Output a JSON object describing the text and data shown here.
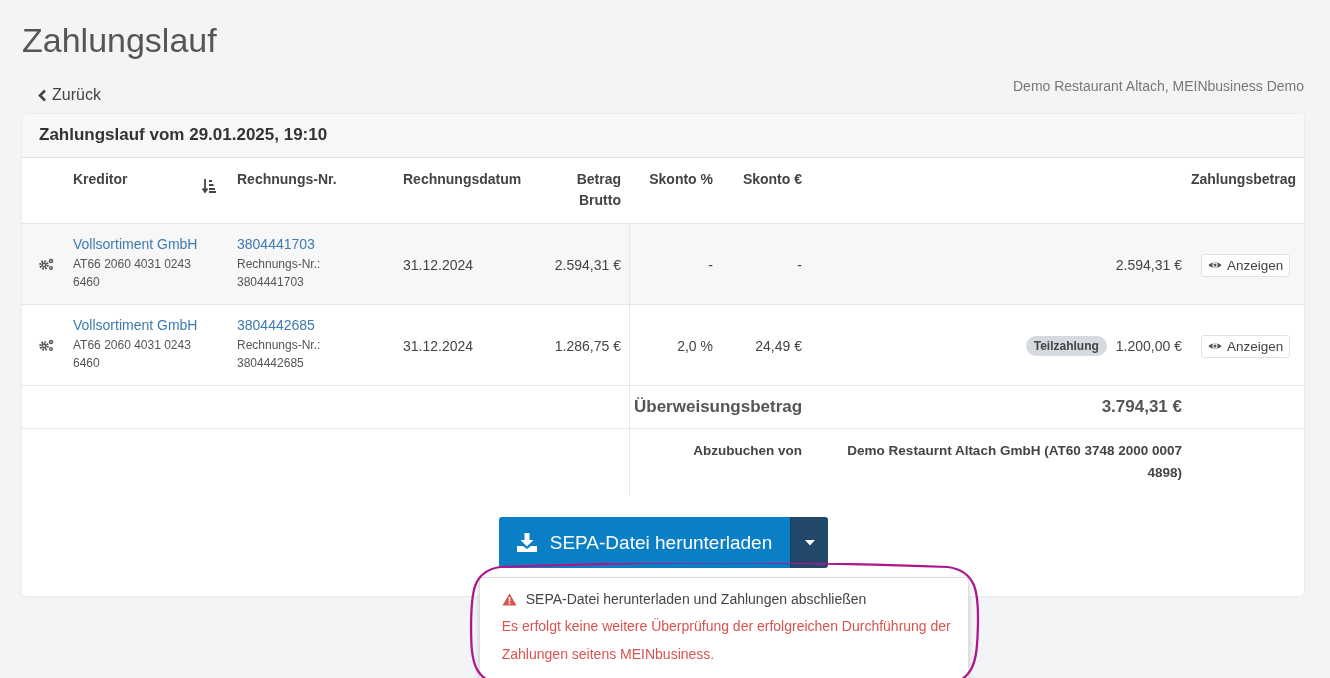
{
  "page": {
    "title": "Zahlungslauf",
    "back_link": "Zurück",
    "company": "Demo Restaurant Altach, MEINbusiness Demo"
  },
  "card": {
    "title": "Zahlungslauf vom 29.01.2025, 19:10"
  },
  "table": {
    "columns": [
      {
        "label": "Kreditor",
        "sorted": true
      },
      {
        "label": "Rechnungs-Nr.",
        "sorted": false
      },
      {
        "label": "Rechnungsdatum",
        "sorted": false
      },
      {
        "label": "Betrag Brutto",
        "sorted": false
      },
      {
        "label": "Skonto %",
        "sorted": false
      },
      {
        "label": "Skonto €",
        "sorted": false
      },
      {
        "label": "Zahlungsbetrag",
        "sorted": false
      }
    ],
    "rows": [
      {
        "creditor": "Vollsortiment GmbH",
        "iban": "AT66 2060 4031 0243 6460",
        "invoice_no": "3804441703",
        "invoice_label": "Rechnungs-Nr.:",
        "invoice_no_sub": "3804441703",
        "date": "31.12.2024",
        "gross": "2.594,31 €",
        "discount_pct": "-",
        "discount_eur": "-",
        "payment": "2.594,31 €",
        "action": "Anzeigen"
      },
      {
        "creditor": "Vollsortiment GmbH",
        "iban": "AT66 2060 4031 0243 6460",
        "invoice_no": "3804442685",
        "invoice_label": "Rechnungs-Nr.:",
        "invoice_no_sub": "3804442685",
        "date": "31.12.2024",
        "gross": "1.286,75 €",
        "discount_pct": "2,0 %",
        "discount_eur": "24,49 €",
        "badge": "Teilzahlung",
        "payment": "1.200,00 €",
        "action": "Anzeigen"
      }
    ],
    "summary": [
      {
        "kind": "total",
        "label": "Überweisungsbetrag",
        "value": "3.794,31 €"
      },
      {
        "kind": "account",
        "label": "Abzubuchen von",
        "value": "Demo Restaurnt Altach GmbH (AT60 3748 2000 0007 4898)"
      }
    ]
  },
  "download": {
    "label": "SEPA-Datei herunterladen",
    "expanded": true,
    "menu": {
      "title": "SEPA-Datei herunterladen und Zahlungen abschließen",
      "warning": "Es erfolgt keine weitere Überprüfung der erfolgreichen Durchführung der Zahlungen seitens MEINbusiness.",
      "circled": true
    }
  }
}
